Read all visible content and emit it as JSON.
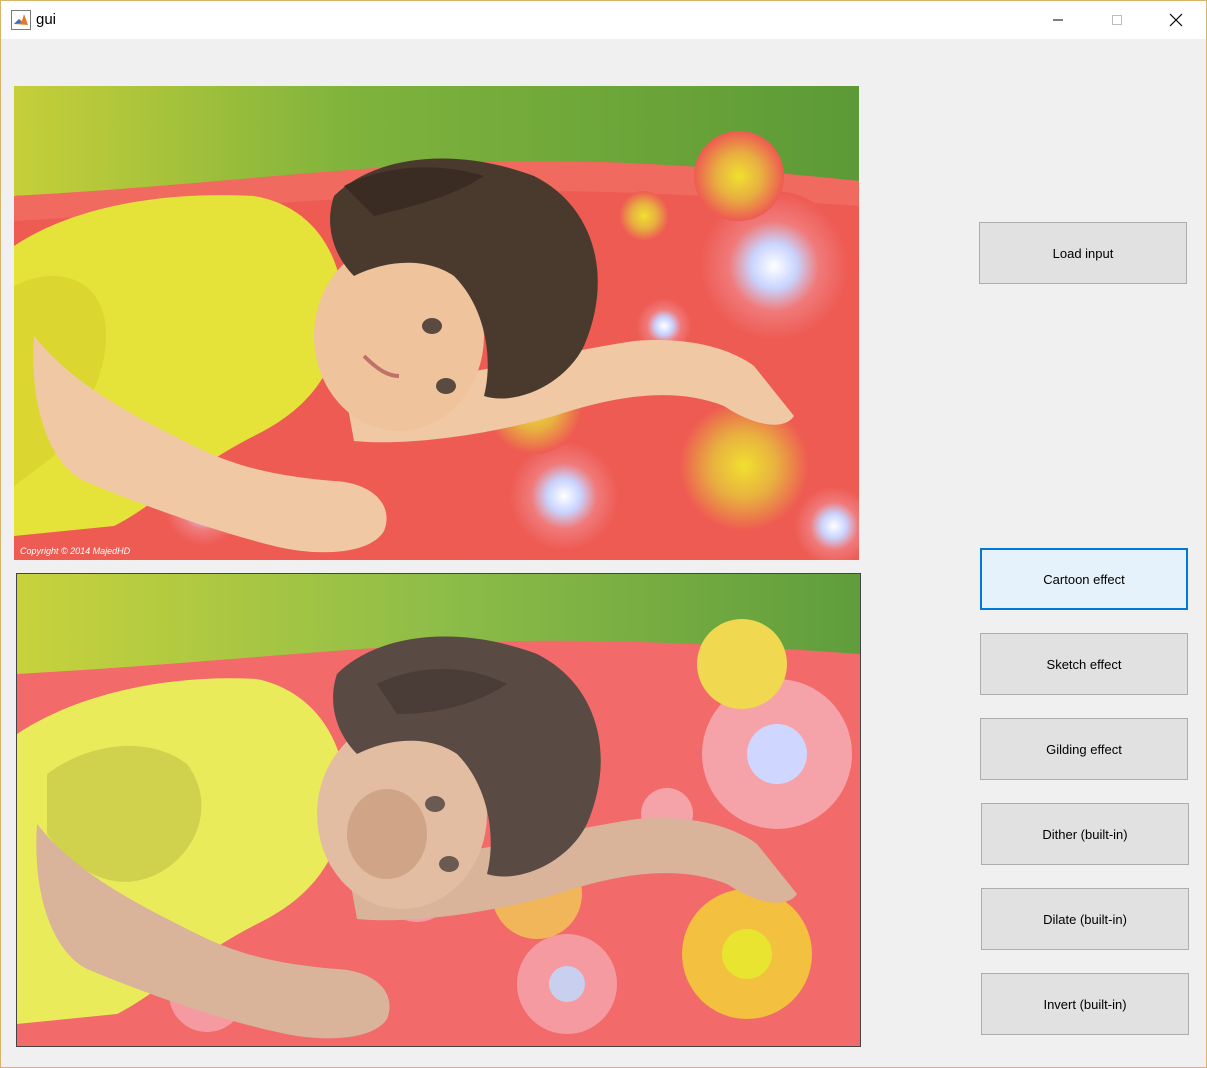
{
  "window": {
    "title": "gui"
  },
  "axes": {
    "input_copyright": "Copyright © 2014 MajedHD"
  },
  "buttons": {
    "load_input": "Load input",
    "cartoon": "Cartoon effect",
    "sketch": "Sketch effect",
    "gilding": "Gilding effect",
    "dither": "Dither (built-in)",
    "dilate": "Dilate (built-in)",
    "invert": "Invert (built-in)"
  },
  "state": {
    "focused_button": "cartoon"
  },
  "colors": {
    "client_bg": "#f0f0f0",
    "button_bg": "#e1e1e1",
    "button_active_bg": "#e5f1fb",
    "focus_accent": "#0078d7"
  }
}
